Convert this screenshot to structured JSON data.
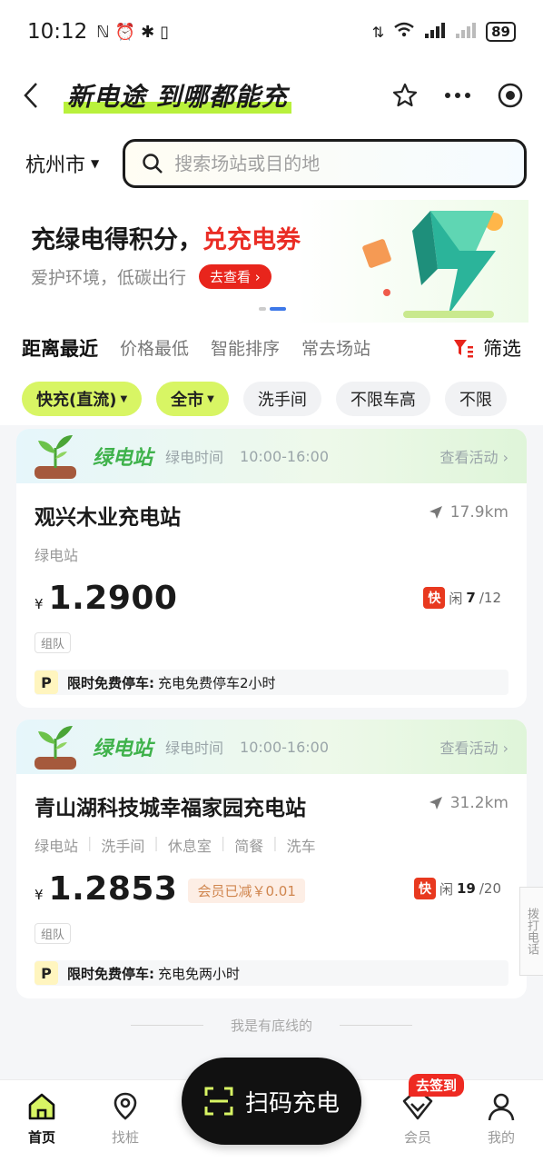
{
  "status_bar": {
    "time": "10:12",
    "left_icons": [
      "nfc-icon",
      "alarm-icon",
      "bluetooth-icon",
      "vibrate-icon"
    ],
    "right_icons": [
      "network-icon",
      "wifi-icon",
      "signal-icon",
      "signal2-icon"
    ],
    "battery": "89"
  },
  "header": {
    "title": "新电途 到哪都能充"
  },
  "search": {
    "city": "杭州市",
    "placeholder": "搜索场站或目的地"
  },
  "banner": {
    "title_part1": "充绿电得积分，",
    "title_part2": "兑充电券",
    "subtitle": "爱护环境，低碳出行",
    "button": "去查看 ›"
  },
  "sort_tabs": {
    "items": [
      "距离最近",
      "价格最低",
      "智能排序",
      "常去场站"
    ],
    "filter": "筛选"
  },
  "chips": [
    {
      "label": "快充(直流)",
      "on": true
    },
    {
      "label": "全市",
      "on": true
    },
    {
      "label": "洗手间",
      "on": false
    },
    {
      "label": "不限车高",
      "on": false
    },
    {
      "label": "不限",
      "on": false
    }
  ],
  "stations": [
    {
      "badge": "绿电站",
      "period_label": "绿电时间",
      "period": "10:00-16:00",
      "activity": "查看活动 ›",
      "name": "观兴木业充电站",
      "distance": "17.9km",
      "tags": [
        "绿电站"
      ],
      "price": "1.2900",
      "yen": "¥",
      "member_discount": "",
      "fast": "快",
      "free_prefix": "闲",
      "free": "7",
      "total": "/12",
      "operator": "组队",
      "park_p": "P",
      "park_title": "限时免费停车:",
      "park_text": "充电免费停车2小时"
    },
    {
      "badge": "绿电站",
      "period_label": "绿电时间",
      "period": "10:00-16:00",
      "activity": "查看活动 ›",
      "name": "青山湖科技城幸福家园充电站",
      "distance": "31.2km",
      "tags": [
        "绿电站",
        "洗手间",
        "休息室",
        "简餐",
        "洗车"
      ],
      "price": "1.2853",
      "yen": "¥",
      "member_discount": "会员已减￥0.01",
      "fast": "快",
      "free_prefix": "闲",
      "free": "19",
      "total": "/20",
      "operator": "组队",
      "park_p": "P",
      "park_title": "限时免费停车:",
      "park_text": "充电免两小时"
    }
  ],
  "side_tab": "拨打电话",
  "bottom_line": "我是有底线的",
  "tabbar": {
    "home": "首页",
    "find": "找桩",
    "scan": "扫码充电",
    "member": "会员",
    "mine": "我的",
    "signin_badge": "去签到"
  },
  "colors": {
    "accent_green": "#d8f564",
    "green_text": "#3fb24b",
    "red": "#e8251c",
    "dark": "#111111"
  }
}
